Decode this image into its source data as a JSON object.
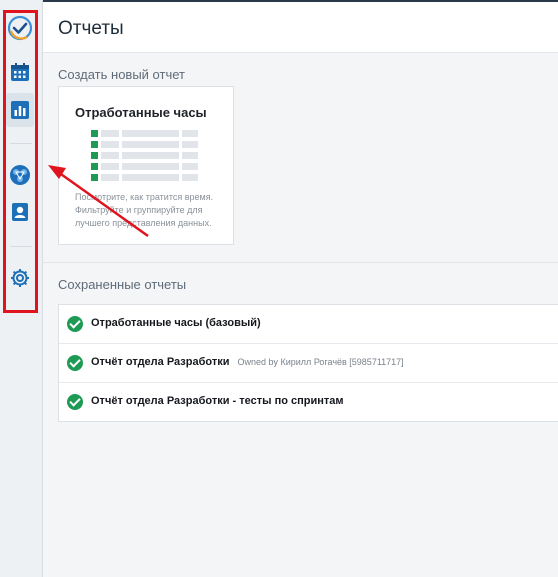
{
  "header": {
    "title": "Отчеты"
  },
  "sidebar": {
    "items": [
      {
        "icon": "logo-check-icon"
      },
      {
        "icon": "calendar-icon"
      },
      {
        "icon": "reports-chart-icon"
      },
      {
        "icon": "team-network-icon"
      },
      {
        "icon": "user-card-icon"
      },
      {
        "icon": "settings-gear-icon"
      }
    ]
  },
  "create": {
    "section_title": "Создать новый отчет",
    "card": {
      "title": "Отработанные часы",
      "description": "Посмотрите, как тратится время. Фильтруйте и группируйте для лучшего представления данных."
    }
  },
  "saved": {
    "section_title": "Сохраненные отчеты",
    "items": [
      {
        "title": "Отработанные часы (базовый)",
        "owner": ""
      },
      {
        "title": "Отчёт отдела Разработки",
        "owner": "Owned by Кирилл Рогачёв [5985711717]"
      },
      {
        "title": "Отчёт отдела Разработки - тесты по спринтам",
        "owner": ""
      }
    ]
  },
  "colors": {
    "accent_green": "#1e9a55",
    "annotation_red": "#e0141e",
    "brand_blue": "#1d6fb8"
  }
}
